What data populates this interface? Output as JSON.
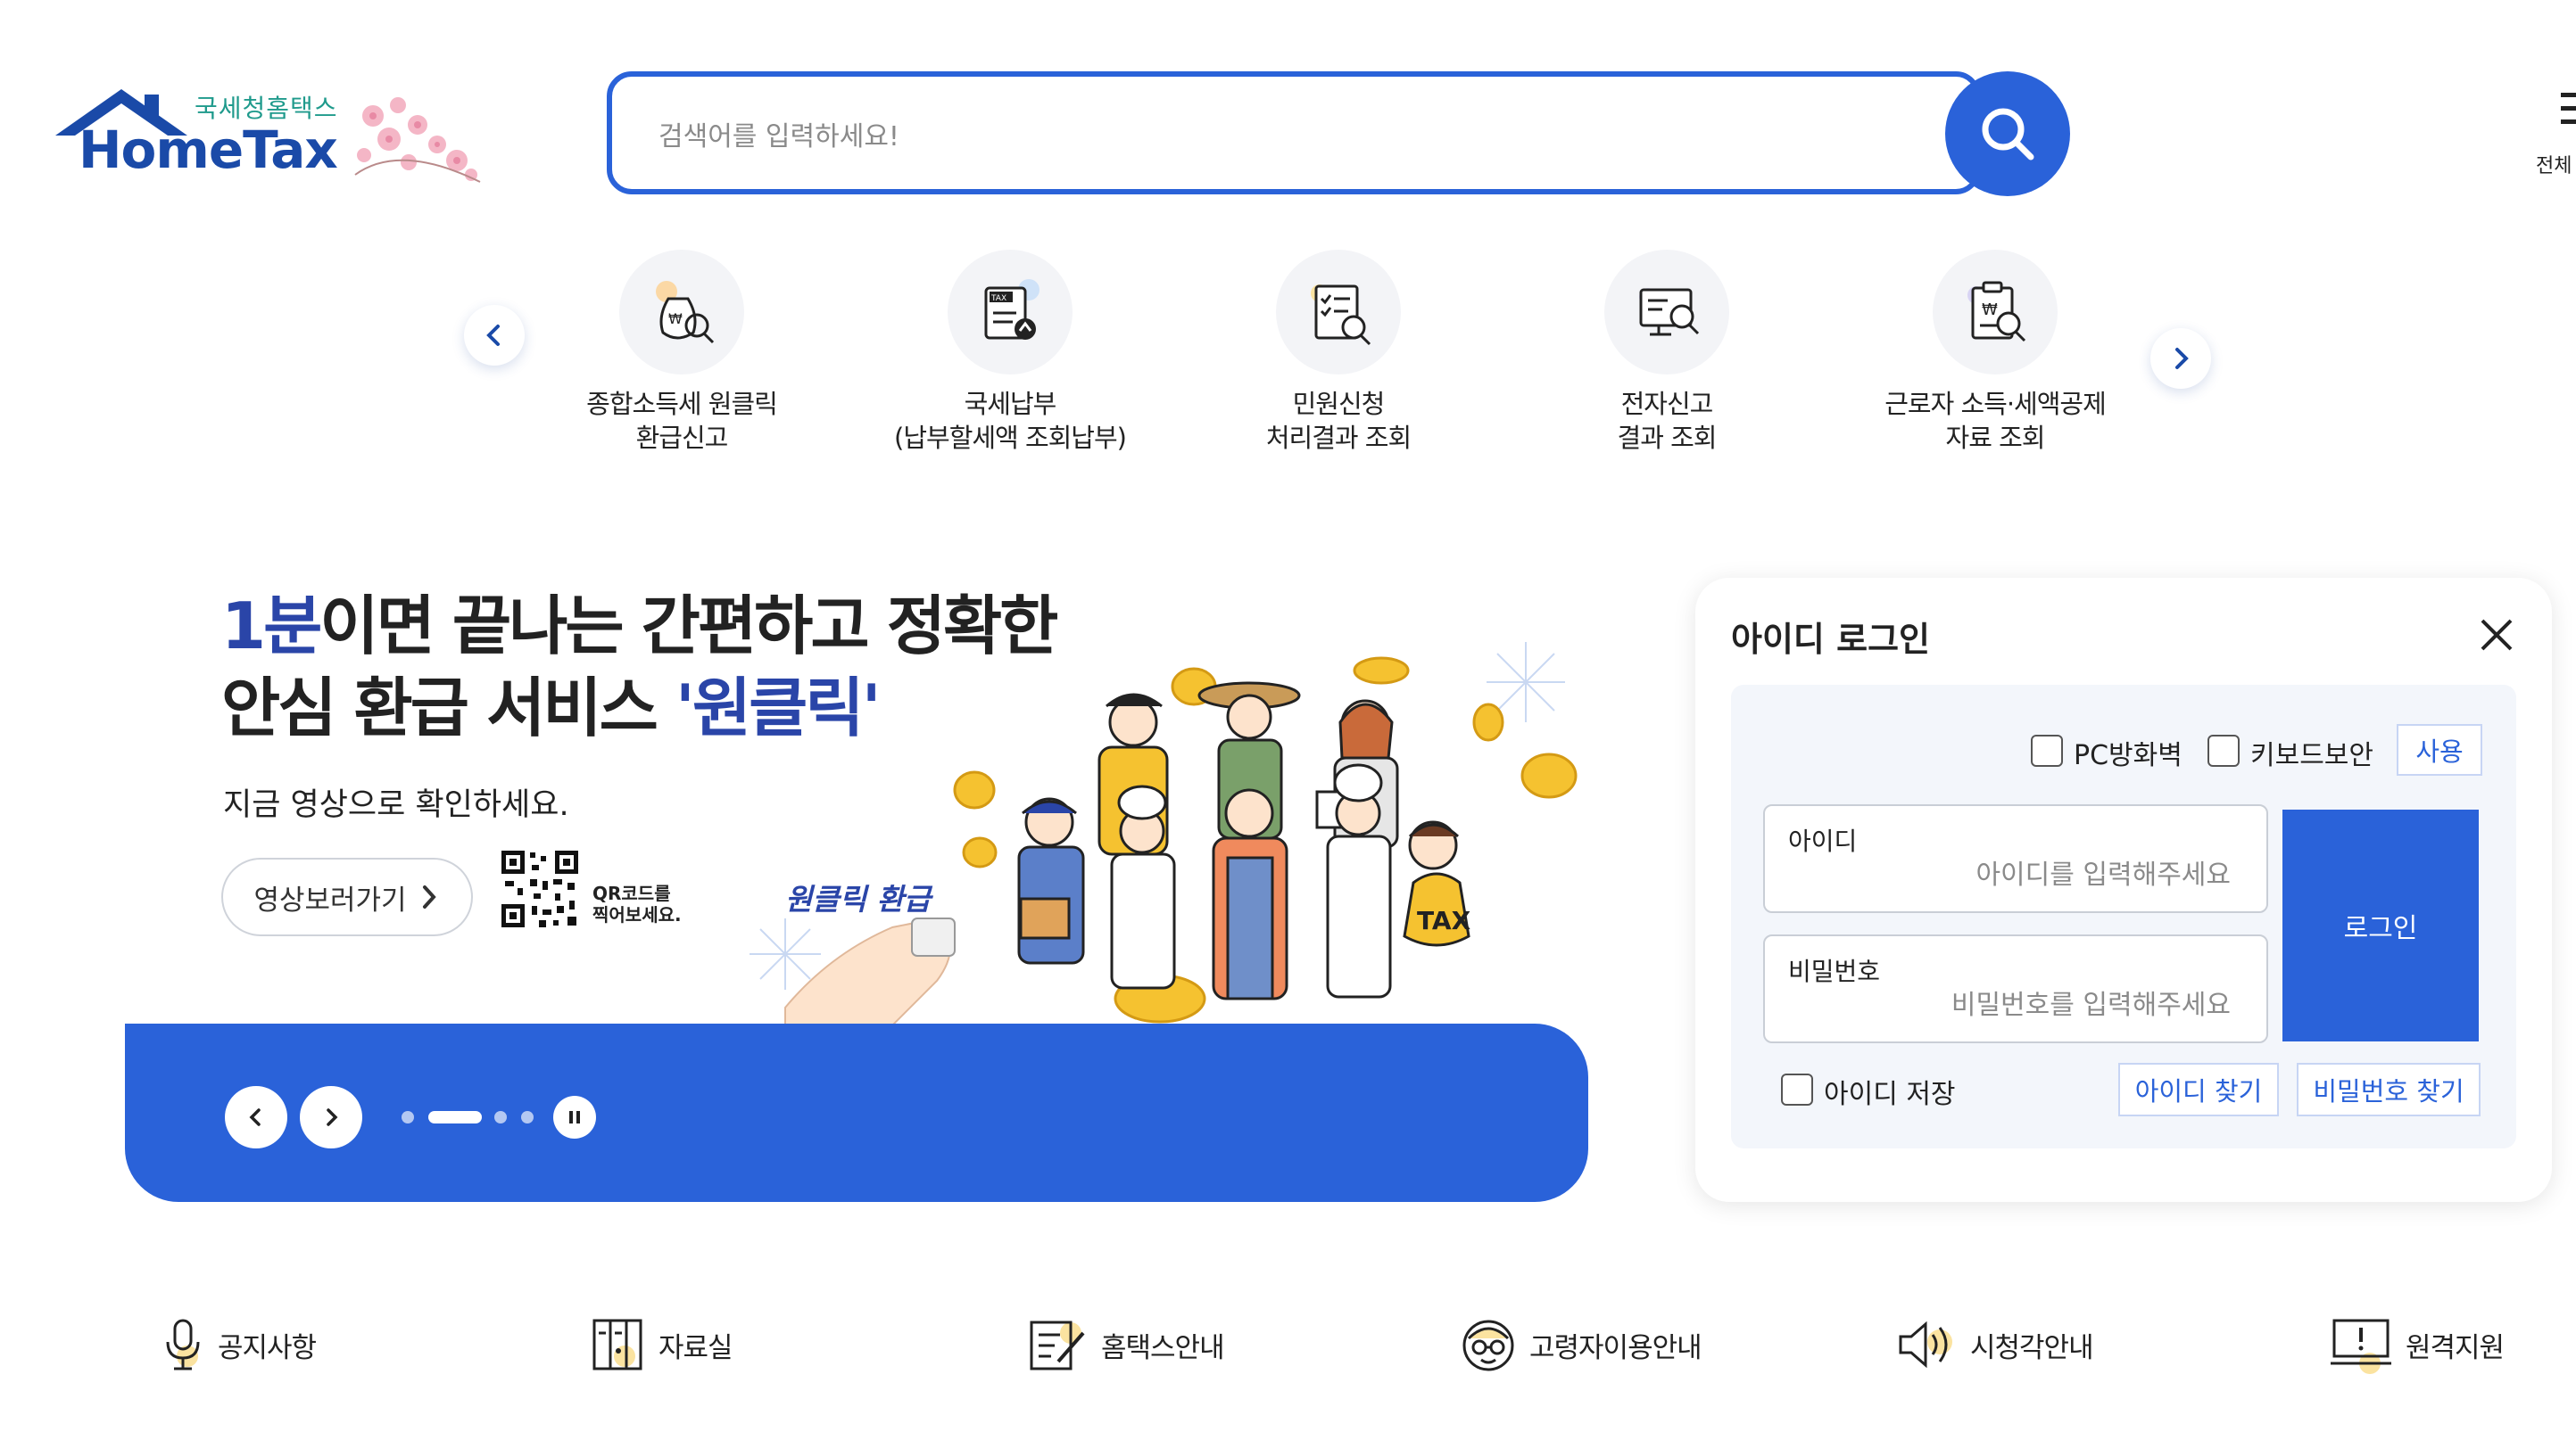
{
  "header": {
    "logo_kor": "국세청홈택스",
    "logo_en": "HomeTax",
    "search_placeholder": "검색어를 입력하세요!",
    "menu_label": "전체"
  },
  "quick_menu": [
    {
      "label_line1": "종합소득세 원클릭",
      "label_line2": "환급신고",
      "icon": "money-bag-icon"
    },
    {
      "label_line1": "국세납부",
      "label_line2": "(납부할세액 조회납부)",
      "icon": "tax-payment-icon"
    },
    {
      "label_line1": "민원신청",
      "label_line2": "처리결과 조회",
      "icon": "document-search-icon"
    },
    {
      "label_line1": "전자신고",
      "label_line2": "결과 조회",
      "icon": "monitor-search-icon"
    },
    {
      "label_line1": "근로자 소득·세액공제",
      "label_line2": "자료 조회",
      "icon": "clipboard-search-icon"
    }
  ],
  "banner": {
    "title_highlight": "1분",
    "title_line1_rest": "이면 끝나는 간편하고 정확한",
    "title_line2_pre": "안심 환급 서비스 ",
    "title_line2_highlight": "'원클릭'",
    "subtitle": "지금 영상으로 확인하세요.",
    "button_label": "영상보러가기",
    "qr_line1": "QR코드를",
    "qr_line2": "찍어보세요.",
    "oneclick_label": "원클릭 환급",
    "tax_bag_label": "TAX"
  },
  "login": {
    "title": "아이디 로그인",
    "pc_firewall": "PC방화벽",
    "keyboard_security": "키보드보안",
    "use_button": "사용",
    "id_label": "아이디",
    "id_placeholder": "아이디를 입력해주세요",
    "pw_label": "비밀번호",
    "pw_placeholder": "비밀번호를 입력해주세요",
    "login_button": "로그인",
    "save_id": "아이디 저장",
    "find_id": "아이디 찾기",
    "find_pw": "비밀번호 찾기"
  },
  "bottom_nav": [
    {
      "label": "공지사항",
      "icon": "microphone-icon"
    },
    {
      "label": "자료실",
      "icon": "binder-icon"
    },
    {
      "label": "홈택스안내",
      "icon": "document-pen-icon"
    },
    {
      "label": "고령자이용안내",
      "icon": "elderly-icon"
    },
    {
      "label": "시청각안내",
      "icon": "speaker-icon"
    },
    {
      "label": "원격지원",
      "icon": "remote-support-icon"
    }
  ],
  "colors": {
    "primary": "#2a62d9",
    "navy": "#2a45a8",
    "logo_teal": "#1f9a8c"
  }
}
